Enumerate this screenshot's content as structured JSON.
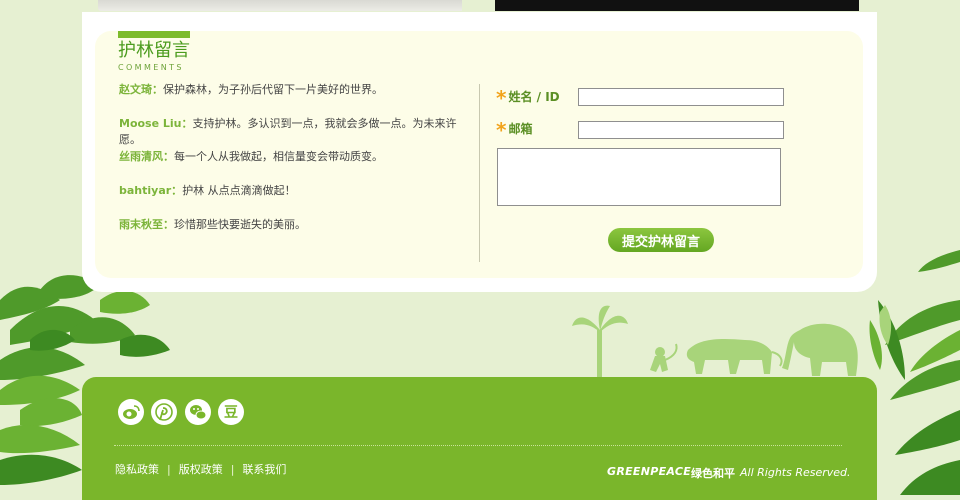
{
  "section": {
    "title": "护林留言",
    "subtitle": "COMMENTS"
  },
  "comments": [
    {
      "name": "赵文琦：",
      "text": "保护森林，为子孙后代留下一片美好的世界。"
    },
    {
      "name": "Moose Liu：",
      "text": "支持护林。多认识到一点，我就会多做一点。为未来许愿。"
    },
    {
      "name": "丝雨清风：",
      "text": "每一个人从我做起，相信量变会带动质变。"
    },
    {
      "name": "bahtiyar：",
      "text": "护林 从点点滴滴做起！"
    },
    {
      "name": "雨末秋至：",
      "text": "珍惜那些快要逝失的美丽。"
    }
  ],
  "form": {
    "star": "*",
    "name_label": "姓名 / ID",
    "email_label": "邮箱",
    "name_value": "",
    "email_value": "",
    "message_value": "",
    "submit_label": "提交护林留言"
  },
  "footer": {
    "social_icons": [
      "weibo-icon",
      "pinterest-icon",
      "wechat-icon",
      "douban-icon"
    ],
    "douban_glyph": "豆",
    "links": [
      "隐私政策",
      "版权政策",
      "联系我们"
    ],
    "link_separator": "|",
    "logo_en": "GREENPEACE",
    "logo_cn": "绿色和平",
    "rights": "All Rights Reserved."
  },
  "colors": {
    "accent_green": "#7ab62b",
    "name_green": "#7cb43a",
    "star_orange": "#f2a31b",
    "panel_bg": "#fdfde8",
    "page_bg": "#e6f0d2"
  }
}
